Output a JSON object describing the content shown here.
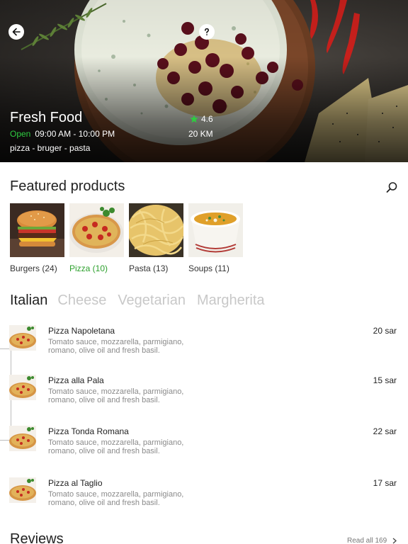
{
  "store": {
    "name": "Fresh Food",
    "status": "Open",
    "hours": "09:00 AM - 10:00 PM",
    "tags": "pizza - bruger - pasta",
    "rating": "4.6",
    "distance": "20 KM"
  },
  "featured": {
    "title": "Featured products",
    "categories": [
      {
        "label": "Burgers (24)",
        "icon": "burger-photo"
      },
      {
        "label": "Pizza (10)",
        "icon": "pizza-photo",
        "active": true
      },
      {
        "label": "Pasta (13)",
        "icon": "pasta-photo"
      },
      {
        "label": "Soups (11)",
        "icon": "soup-photo"
      }
    ]
  },
  "tabs": [
    "Italian",
    "Cheese",
    "Vegetarian",
    "Margherita"
  ],
  "menu_items": [
    {
      "name": "Pizza Napoletana",
      "price": "20 sar",
      "description": "Tomato sauce, mozzarella, parmigiano, romano, olive oil and fresh basil."
    },
    {
      "name": "Pizza alla Pala",
      "price": "15 sar",
      "description": "Tomato sauce, mozzarella, parmigiano, romano, olive oil and fresh basil."
    },
    {
      "name": "Pizza Tonda Romana",
      "price": "22 sar",
      "description": "Tomato sauce, mozzarella, parmigiano, romano, olive oil and fresh basil."
    },
    {
      "name": "Pizza al Taglio",
      "price": "17 sar",
      "description": "Tomato sauce, mozzarella, parmigiano, romano, olive oil and fresh basil."
    }
  ],
  "reviews": {
    "title": "Reviews",
    "read_all": "Read all 169"
  },
  "colors": {
    "accent_green": "#2ca02c",
    "open_green": "#2ecc40",
    "star_green": "#2ecc40"
  },
  "icons": [
    "back-arrow-icon",
    "help-icon",
    "star-icon",
    "search-icon",
    "chevron-right-icon"
  ]
}
